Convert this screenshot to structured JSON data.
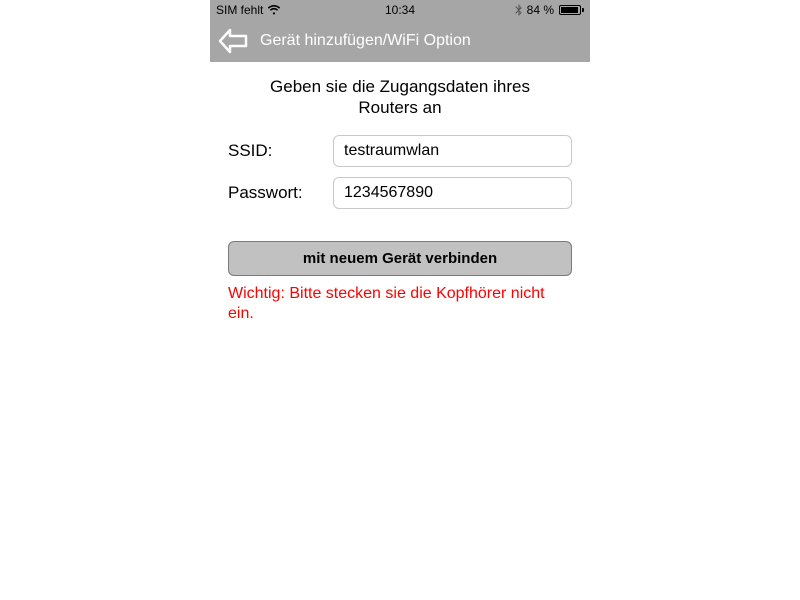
{
  "status": {
    "carrier": "SIM fehlt",
    "time": "10:34",
    "battery_pct": "84 %"
  },
  "nav": {
    "title": "Gerät hinzufügen/WiFi Option"
  },
  "form": {
    "instruction": "Geben sie die Zugangsdaten ihres Routers an",
    "ssid_label": "SSID:",
    "ssid_value": "testraumwlan",
    "password_label": "Passwort:",
    "password_value": "1234567890",
    "connect_label": "mit neuem Gerät verbinden",
    "warning": "Wichtig: Bitte stecken sie die Kopfhörer nicht ein."
  }
}
